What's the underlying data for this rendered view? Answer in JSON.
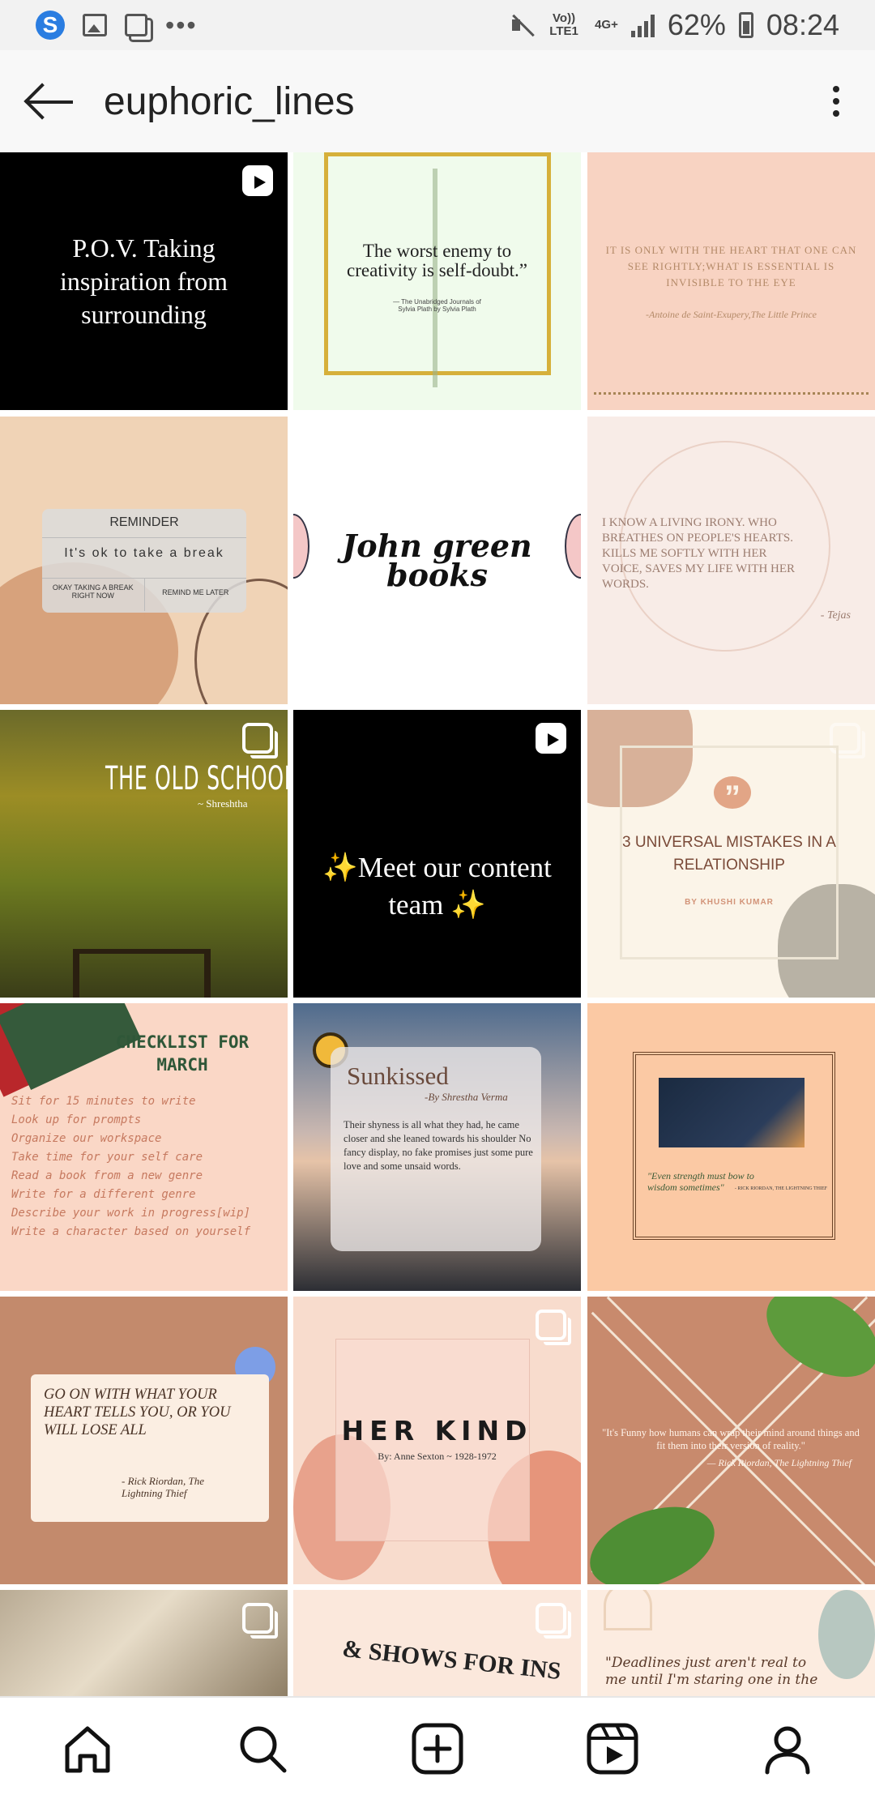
{
  "status_bar": {
    "network_label_1": "Vo)) LTE1",
    "network_label_2": "4G+",
    "battery": "62%",
    "time": "08:24",
    "icons": [
      "s-app-icon",
      "gallery-icon",
      "screenshot-icon",
      "more-icon",
      "mute-icon",
      "signal-icon",
      "battery-icon"
    ]
  },
  "header": {
    "title": "euphoric_lines",
    "back_icon": "arrow-left-icon",
    "menu_icon": "more-vertical-icon"
  },
  "posts": [
    {
      "id": "pov",
      "text": "P.O.V. Taking inspiration from surrounding",
      "badge": "reel"
    },
    {
      "id": "worst-enemy",
      "text": "The worst enemy to creativity is self-doubt.”",
      "sub": "— The Unabridged Journals of Sylvia Plath by Sylvia Plath"
    },
    {
      "id": "heart",
      "text": "IT IS ONLY WITH THE HEART THAT ONE CAN SEE RIGHTLY;WHAT IS ESSENTIAL IS INVISIBLE TO THE EYE",
      "sub": "-Antoine de Saint-Exupery,The Little Prince"
    },
    {
      "id": "reminder",
      "title": "REMINDER",
      "text": "It's ok to take a break",
      "btn1": "OKAY TAKING A BREAK RIGHT NOW",
      "btn2": "REMIND ME LATER"
    },
    {
      "id": "john-green",
      "text": "John green books"
    },
    {
      "id": "irony",
      "text": "I KNOW A LIVING IRONY. WHO BREATHES ON PEOPLE'S HEARTS. KILLS ME SOFTLY WITH HER VOICE, SAVES MY LIFE WITH HER WORDS.",
      "sub": "- Tejas"
    },
    {
      "id": "old-school",
      "text": "THE OLD SCHOOL",
      "sub": "~ Shreshtha",
      "badge": "multi"
    },
    {
      "id": "content-team",
      "text": "✨Meet our content team ✨",
      "badge": "reel"
    },
    {
      "id": "mistakes",
      "text": "3 UNIVERSAL MISTAKES IN A RELATIONSHIP",
      "sub": "BY KHUSHI KUMAR",
      "badge": "multi"
    },
    {
      "id": "checklist",
      "title": "CHECKLIST FOR MARCH",
      "items": [
        "Sit for 15 minutes to write",
        "Look up for prompts",
        "Organize our workspace",
        "Take time for your self care",
        "Read a book from a new genre",
        "Write for a different genre",
        "Describe your work in progress[wip]",
        "Write a character based on yourself"
      ]
    },
    {
      "id": "sunkissed",
      "title": "Sunkissed",
      "sub": "-By Shrestha Verma",
      "text": "Their shyness is all what they had, he came closer and she leaned towards his shoulder No fancy display, no fake promises just some pure love and some unsaid words."
    },
    {
      "id": "strength",
      "text": "\"Even strength must bow to wisdom sometimes\"",
      "sub": "- RICK RIORDAN, THE LIGHTNING THIEF"
    },
    {
      "id": "go-on",
      "text": "GO ON WITH WHAT YOUR HEART TELLS YOU, OR YOU WILL LOSE ALL",
      "sub": "- Rick Riordan, The Lightning Thief"
    },
    {
      "id": "her-kind",
      "text": "HER KIND",
      "sub": "By: Anne Sexton ~ 1928-1972",
      "badge": "multi"
    },
    {
      "id": "funny",
      "text": "\"It's Funny how humans can wrap their mind around things and fit them into their version of reality.\"",
      "sub": "— Rick Riordan, The Lightning Thief"
    },
    {
      "id": "book-pages",
      "badge": "multi"
    },
    {
      "id": "shows",
      "text": "& SHOWS FOR INS",
      "badge": "multi"
    },
    {
      "id": "deadlines",
      "text": "\"Deadlines just aren't real to me until I'm staring one in the"
    }
  ],
  "bottom_nav": {
    "items": [
      "home-icon",
      "search-icon",
      "create-icon",
      "reels-icon",
      "profile-icon"
    ]
  },
  "colors": {
    "status_bar_bg": "#f2f2f2",
    "header_bg": "#f8f8f8",
    "peach": "#f8d6c4",
    "terracotta": "#c28a6c"
  }
}
